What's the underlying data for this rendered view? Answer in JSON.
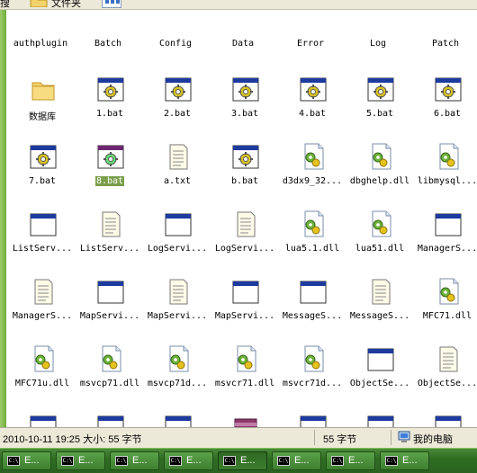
{
  "toolbar": {
    "left_text": "搜",
    "folders_text": "文件夹"
  },
  "columns": [
    "authplugin",
    "Batch",
    "Config",
    "Data",
    "Error",
    "Log",
    "Patch"
  ],
  "rows": [
    [
      {
        "name": "数据库",
        "icon": "folder-icon"
      },
      {
        "name": "1.bat",
        "icon": "bat-file-icon"
      },
      {
        "name": "2.bat",
        "icon": "bat-file-icon"
      },
      {
        "name": "3.bat",
        "icon": "bat-file-icon"
      },
      {
        "name": "4.bat",
        "icon": "bat-file-icon"
      },
      {
        "name": "5.bat",
        "icon": "bat-file-icon"
      },
      {
        "name": "6.bat",
        "icon": "bat-file-icon"
      }
    ],
    [
      {
        "name": "7.bat",
        "icon": "bat-file-icon"
      },
      {
        "name": "8.bat",
        "icon": "bat-file-icon",
        "selected": true
      },
      {
        "name": "a.txt",
        "icon": "text-file-icon"
      },
      {
        "name": "b.bat",
        "icon": "bat-file-icon"
      },
      {
        "name": "d3dx9_32...",
        "icon": "dll-file-icon"
      },
      {
        "name": "dbghelp.dll",
        "icon": "dll-file-icon"
      },
      {
        "name": "libmysql...",
        "icon": "dll-file-icon"
      }
    ],
    [
      {
        "name": "ListServ...",
        "icon": "exe-window-icon"
      },
      {
        "name": "ListServ...",
        "icon": "text-file-icon"
      },
      {
        "name": "LogServi...",
        "icon": "exe-window-icon"
      },
      {
        "name": "LogServi...",
        "icon": "text-file-icon"
      },
      {
        "name": "lua5.1.dll",
        "icon": "dll-file-icon"
      },
      {
        "name": "lua51.dll",
        "icon": "dll-file-icon"
      },
      {
        "name": "ManagerS...",
        "icon": "exe-window-icon"
      }
    ],
    [
      {
        "name": "ManagerS...",
        "icon": "text-file-icon"
      },
      {
        "name": "MapServi...",
        "icon": "exe-window-icon"
      },
      {
        "name": "MapServi...",
        "icon": "text-file-icon"
      },
      {
        "name": "MapServi...",
        "icon": "exe-window-icon"
      },
      {
        "name": "MessageS...",
        "icon": "exe-window-icon"
      },
      {
        "name": "MessageS...",
        "icon": "text-file-icon"
      },
      {
        "name": "MFC71.dll",
        "icon": "dll-file-icon"
      }
    ],
    [
      {
        "name": "MFC71u.dll",
        "icon": "dll-file-icon"
      },
      {
        "name": "msvcp71.dll",
        "icon": "dll-file-icon"
      },
      {
        "name": "msvcp71d...",
        "icon": "dll-file-icon"
      },
      {
        "name": "msvcr71.dll",
        "icon": "dll-file-icon"
      },
      {
        "name": "msvcr71d...",
        "icon": "dll-file-icon"
      },
      {
        "name": "ObjectSe...",
        "icon": "exe-window-icon"
      },
      {
        "name": "ObjectSe...",
        "icon": "text-file-icon"
      }
    ],
    [
      {
        "name": "",
        "icon": "exe-window-icon"
      },
      {
        "name": "",
        "icon": "exe-window-icon"
      },
      {
        "name": "",
        "icon": "exe-window-icon"
      },
      {
        "name": "",
        "icon": "archive-icon"
      },
      {
        "name": "",
        "icon": "exe-window-icon"
      },
      {
        "name": "",
        "icon": "exe-window-icon"
      },
      {
        "name": "",
        "icon": "exe-window-icon"
      }
    ]
  ],
  "status": {
    "left": "2010-10-11 19:25  大小: 55 字节",
    "size": "55 字节",
    "location": "我的电脑"
  },
  "taskbar": {
    "items": [
      "E...",
      "E...",
      "E...",
      "E...",
      "E...",
      "E...",
      "E...",
      "E..."
    ],
    "cmd_label": "C:\\",
    "active_index": 4
  },
  "colors": {
    "selected": "#7a9e4a",
    "gutter": "#6fae3c",
    "taskbar": "#2f6e22"
  }
}
